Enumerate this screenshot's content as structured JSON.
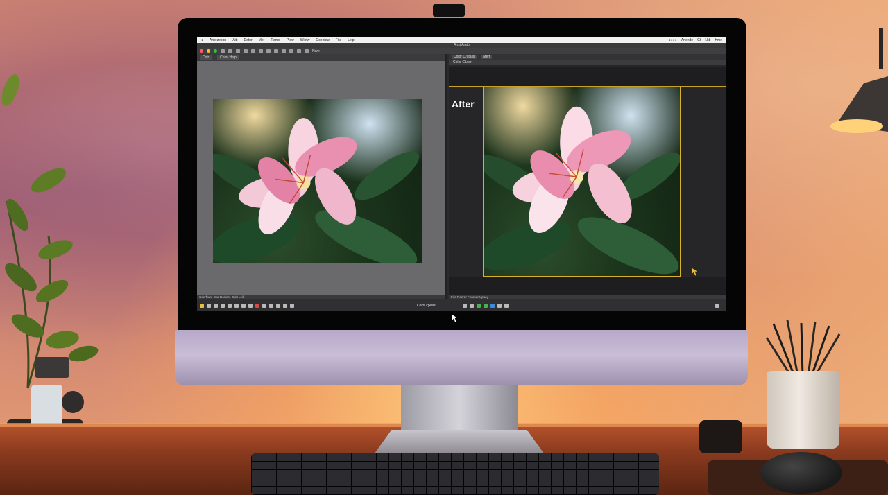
{
  "menubar": {
    "items": [
      "Anorzeoon",
      "Aitt",
      "Dotor",
      "Mer",
      "Rener",
      "Piew",
      "Wietw",
      "Oceniew",
      "Fite",
      "Leip"
    ],
    "right_items": [
      "Anende",
      "Gt",
      "Lkb",
      "Hme"
    ]
  },
  "window": {
    "title": "Anst Amtp"
  },
  "toolbar": {
    "navigate_label": "Nare+"
  },
  "left_panel": {
    "tabs": [
      "Colr",
      "Color Halp"
    ],
    "footer": "Coerftwre Cwr Dosies · Colt Leik"
  },
  "right_panel": {
    "tabs": [
      "Color Crutails",
      "Mert"
    ],
    "subtab": "Color Cluter",
    "after_label": "After",
    "footer": "Fire  Roerer  Fearoer Upaey"
  },
  "bottombar": {
    "status": "Color cpeast"
  },
  "colors": {
    "guide": "#c8a02a",
    "accent_yellow": "#d8b030"
  }
}
